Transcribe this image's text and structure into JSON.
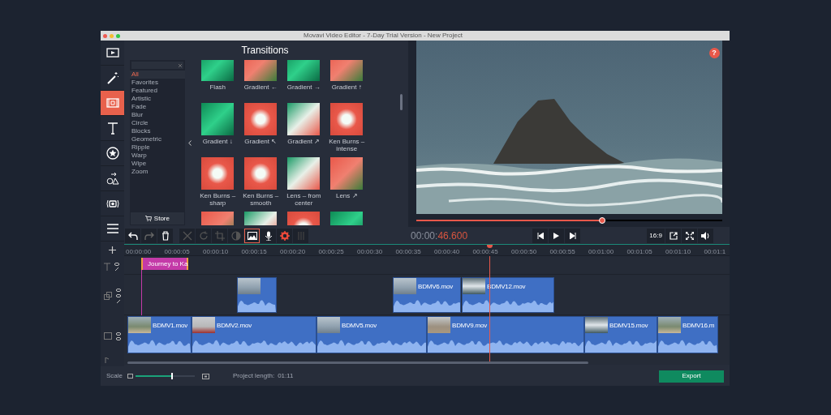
{
  "window": {
    "title": "Movavi Video Editor - 7-Day Trial Version - New Project"
  },
  "sidebar": [
    {
      "kind": "media",
      "selected": false
    },
    {
      "kind": "wand",
      "selected": false
    },
    {
      "kind": "transitions",
      "selected": true
    },
    {
      "kind": "text",
      "selected": false
    },
    {
      "kind": "sticker",
      "selected": false
    },
    {
      "kind": "shapes",
      "selected": false
    },
    {
      "kind": "capture",
      "selected": false
    },
    {
      "kind": "list",
      "selected": false
    }
  ],
  "transitions": {
    "title": "Transitions",
    "categories": [
      {
        "label": "All",
        "selected": true
      },
      {
        "label": "Favorites",
        "selected": false
      },
      {
        "label": "Featured",
        "selected": false
      },
      {
        "label": "Artistic",
        "selected": false
      },
      {
        "label": "Fade",
        "selected": false
      },
      {
        "label": "Blur",
        "selected": false
      },
      {
        "label": "Circle",
        "selected": false
      },
      {
        "label": "Blocks",
        "selected": false
      },
      {
        "label": "Geometric",
        "selected": false
      },
      {
        "label": "Ripple",
        "selected": false
      },
      {
        "label": "Warp",
        "selected": false
      },
      {
        "label": "Wipe",
        "selected": false
      },
      {
        "label": "Zoom",
        "selected": false
      }
    ],
    "store_button": "Store",
    "items": [
      {
        "label": "Flash",
        "kind": "green"
      },
      {
        "label": "Gradient ←",
        "kind": "red"
      },
      {
        "label": "Gradient →",
        "kind": "green"
      },
      {
        "label": "Gradient ↑",
        "kind": "red"
      },
      {
        "label": "Gradient ↓",
        "kind": "green"
      },
      {
        "label": "Gradient ↖",
        "kind": "flower"
      },
      {
        "label": "Gradient ↗",
        "kind": "mixed"
      },
      {
        "label": "Ken Burns – intense",
        "kind": "flower"
      },
      {
        "label": "Ken Burns – sharp",
        "kind": "flower"
      },
      {
        "label": "Ken Burns – smooth",
        "kind": "flower"
      },
      {
        "label": "Lens – from center",
        "kind": "mixed"
      },
      {
        "label": "Lens ↗",
        "kind": "red"
      },
      {
        "kind": "red"
      },
      {
        "kind": "mixed"
      },
      {
        "kind": "flower"
      },
      {
        "kind": "green"
      }
    ]
  },
  "preview": {
    "level": 0.61,
    "help_button": "?"
  },
  "toolbar": {
    "tools": [
      {
        "kind": "undo",
        "selected": false
      },
      {
        "kind": "redo",
        "selected": false
      },
      {
        "kind": "delete",
        "selected": false
      },
      {
        "kind": "cut",
        "selected": false
      },
      {
        "kind": "rotate",
        "selected": false
      },
      {
        "kind": "crop",
        "selected": false
      },
      {
        "kind": "color",
        "selected": false
      },
      {
        "kind": "image",
        "selected": true
      },
      {
        "kind": "mic",
        "selected": false
      },
      {
        "kind": "gear",
        "selected": false
      },
      {
        "kind": "equalizer",
        "selected": false
      }
    ],
    "timecode": "00:00:",
    "timecode_frames": "46.600",
    "aspect_button": "16:9"
  },
  "ruler": [
    "00:00:00",
    "00:00:05",
    "00:00:10",
    "00:00:15",
    "00:00:20",
    "00:00:25",
    "00:00:30",
    "00:00:35",
    "00:00:40",
    "00:00:45",
    "00:00:50",
    "00:00:55",
    "00:01:00",
    "00:01:05",
    "00:01:10",
    "00:01:1"
  ],
  "title_clip": {
    "label": "Journey to Ka"
  },
  "overlay_clips": [
    {
      "kind": "sea"
    },
    {
      "label": "BDMV6.mov",
      "kind": "sea"
    },
    {
      "label": "BDMV12.mov",
      "kind": "rock"
    }
  ],
  "main_clips": [
    {
      "label": "BDMV1.mov"
    },
    {
      "label": "BDMV2.mov"
    },
    {
      "label": "BDMV5.mov"
    },
    {
      "label": "BDMV9.mov"
    },
    {
      "label": "BDMV15.mov"
    },
    {
      "label": "BDMV16.m"
    }
  ],
  "footer": {
    "scale_label": "Scale",
    "scale": {
      "level": 0.62
    },
    "length_label": "Project length:",
    "length": "01:11",
    "export_button": "Export"
  }
}
